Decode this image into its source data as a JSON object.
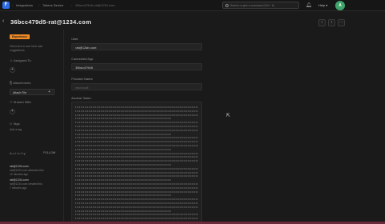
{
  "topbar": {
    "logo_letter": "F",
    "breadcrumbs": [
      "Integrations",
      "Tokens Device",
      "36bcc479d5-rat@1234.com"
    ],
    "search_placeholder": "Search or give a command (Ctrl + K)",
    "help_label": "Help",
    "avatar_initial": "A"
  },
  "page": {
    "title": "36bcc479d5-rat@1234.com"
  },
  "sidebar": {
    "tag": "Experience",
    "description_lines": [
      "Click here to see here add",
      "suggestions"
    ],
    "assigned_to": "Assigned To",
    "attachments": "Attachments",
    "attachment_name": "Attach File",
    "shared_with": "Shared With",
    "tags": "Tags",
    "add_tag": "Add a tag",
    "activity_heading": "Activity",
    "follow": "FOLLOW",
    "activity": [
      {
        "user": "rat@1234.com",
        "desc_lines": [
          "rat@1234.com attached this",
          "12 minutes ago"
        ]
      },
      {
        "user": "rat@1234.com",
        "desc_lines": [
          "rat@1234.com created this",
          "7 minutes ago"
        ]
      }
    ]
  },
  "form": {
    "user_label": "User",
    "user_value": "rat@12ab.com",
    "connected_app_label": "Connected App",
    "connected_app_value": "36bcc479d5",
    "provider_name_label": "Provider Name",
    "provider_name_placeholder": "microsoft",
    "access_token_label": "Access Token"
  }
}
